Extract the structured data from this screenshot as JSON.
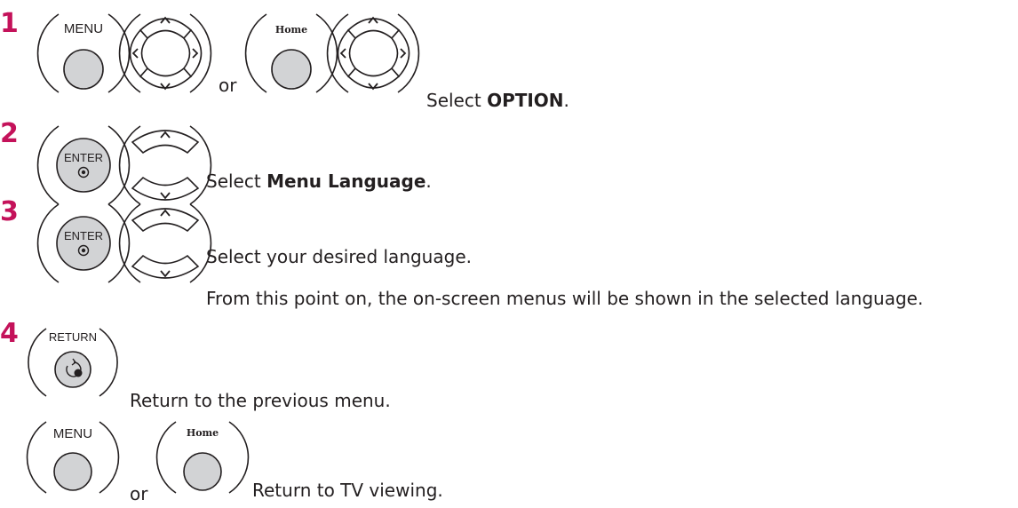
{
  "steps": [
    {
      "number": "1",
      "buttons": [
        "MENU",
        "Home"
      ],
      "connector": "or",
      "instruction_prefix": "Select ",
      "instruction_bold": "OPTION",
      "instruction_suffix": "."
    },
    {
      "number": "2",
      "buttons": [
        "ENTER"
      ],
      "instruction_prefix": "Select ",
      "instruction_bold": "Menu Language",
      "instruction_suffix": "."
    },
    {
      "number": "3",
      "buttons": [
        "ENTER"
      ],
      "instruction": "Select your desired language.",
      "note": "From this point on, the on-screen menus will be shown in the selected language."
    },
    {
      "number": "4",
      "buttons": [
        "RETURN"
      ],
      "instruction": "Return to the previous menu."
    }
  ],
  "final": {
    "buttons": [
      "MENU",
      "Home"
    ],
    "connector": "or",
    "instruction": "Return to TV viewing."
  },
  "colors": {
    "step_number": "#c4125a",
    "button_fill": "#d2d3d5",
    "button_stroke": "#231f20"
  },
  "icons": [
    "menu-button-icon",
    "home-button-icon",
    "four-way-nav-icon",
    "up-down-nav-icon",
    "enter-button-icon",
    "return-button-icon"
  ]
}
